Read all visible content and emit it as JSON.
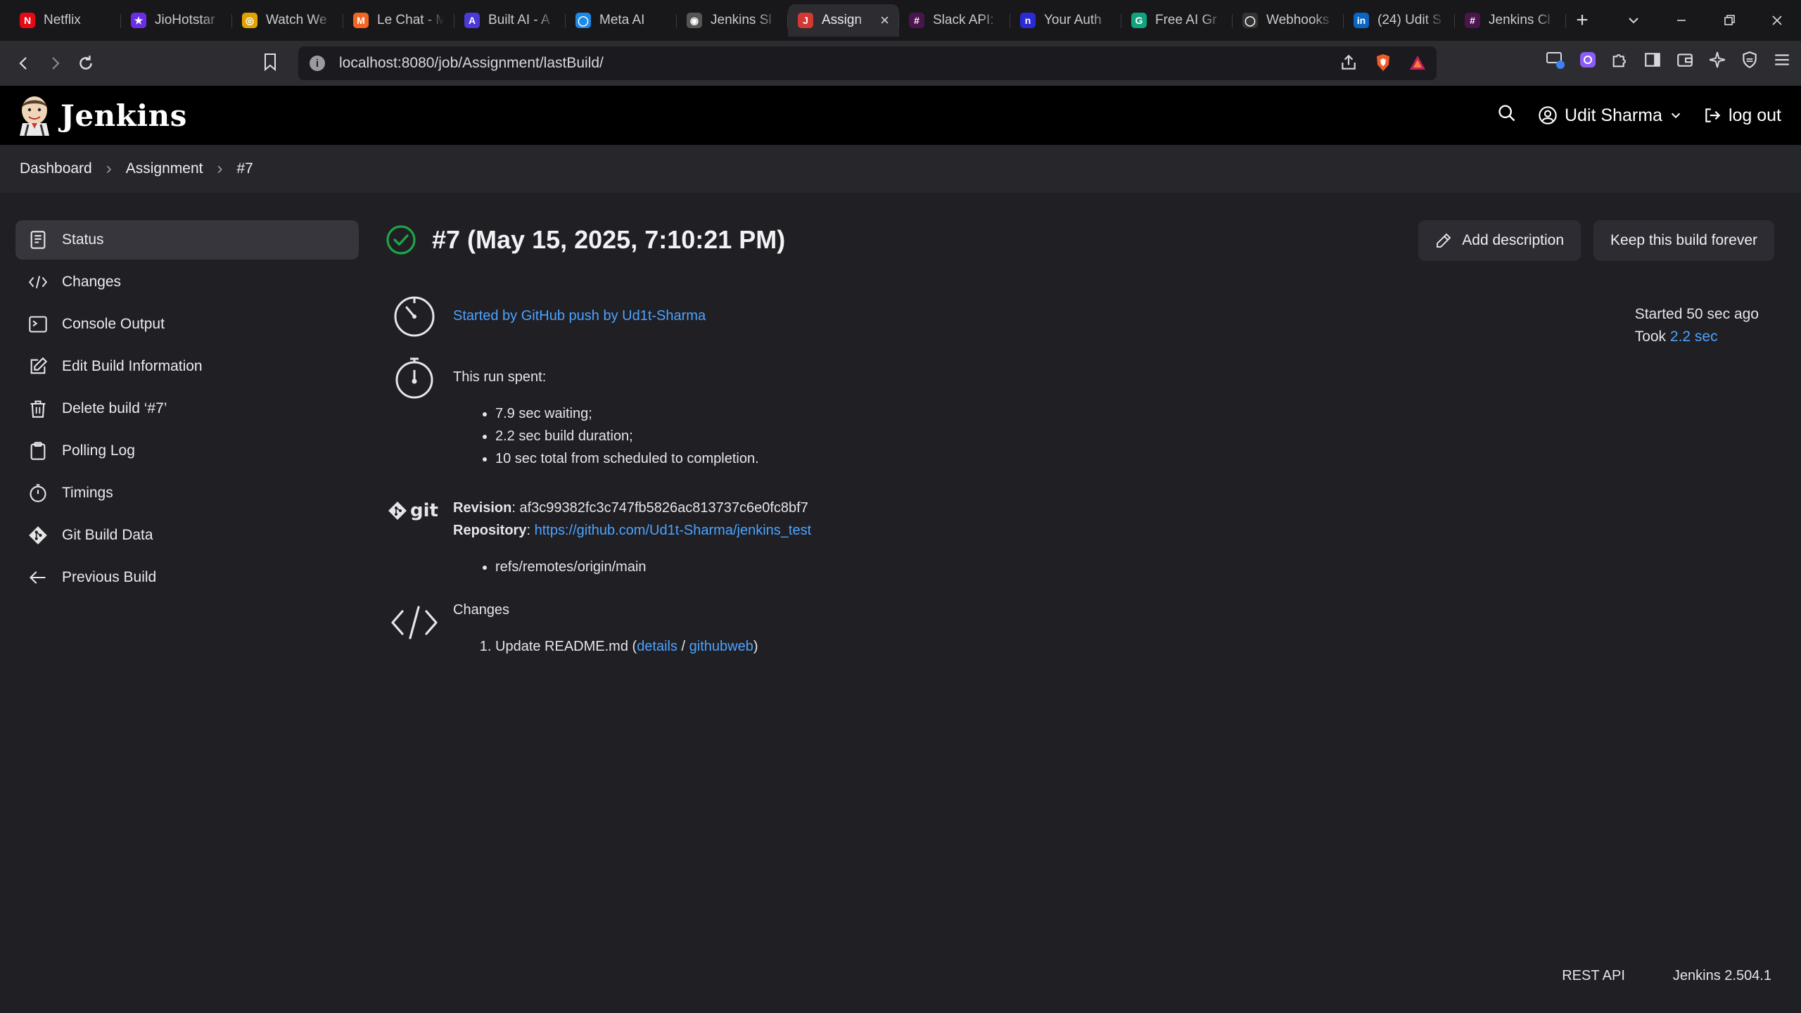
{
  "browser": {
    "tabs": [
      {
        "label": "Netflix",
        "fav_text": "N",
        "fav_color": "#e50914"
      },
      {
        "label": "JioHotstar",
        "fav_text": "★",
        "fav_color": "#6b2ee6"
      },
      {
        "label": "Watch We",
        "fav_text": "◎",
        "fav_color": "#e0a400"
      },
      {
        "label": "Le Chat - M",
        "fav_text": "M",
        "fav_color": "#f26522"
      },
      {
        "label": "Built AI - A",
        "fav_text": "A",
        "fav_color": "#4b3ad6"
      },
      {
        "label": "Meta AI",
        "fav_text": "◯",
        "fav_color": "#1e88e5"
      },
      {
        "label": "Jenkins Sl",
        "fav_text": "◉",
        "fav_color": "#555555"
      },
      {
        "label": "Assign",
        "fav_text": "J",
        "fav_color": "#d33833"
      },
      {
        "label": "Slack API:",
        "fav_text": "#",
        "fav_color": "#4a154b"
      },
      {
        "label": "Your Auth",
        "fav_text": "n",
        "fav_color": "#2b2bd4"
      },
      {
        "label": "Free AI Gr",
        "fav_text": "G",
        "fav_color": "#10a37f"
      },
      {
        "label": "Webhooks",
        "fav_text": "◯",
        "fav_color": "#333333"
      },
      {
        "label": "(24) Udit S",
        "fav_text": "in",
        "fav_color": "#0a66c2"
      },
      {
        "label": "Jenkins Cl",
        "fav_text": "#",
        "fav_color": "#4a154b"
      }
    ],
    "active_tab_index": 7,
    "url": "localhost:8080/job/Assignment/lastBuild/"
  },
  "header": {
    "title": "Jenkins",
    "user": "Udit Sharma",
    "logout": "log out"
  },
  "breadcrumb": [
    "Dashboard",
    "Assignment",
    "#7"
  ],
  "sidebar": {
    "items": [
      {
        "label": "Status",
        "icon": "status-icon",
        "active": true
      },
      {
        "label": "Changes",
        "icon": "code-icon",
        "active": false
      },
      {
        "label": "Console Output",
        "icon": "terminal-icon",
        "active": false
      },
      {
        "label": "Edit Build Information",
        "icon": "edit-icon",
        "active": false
      },
      {
        "label": "Delete build ‘#7’",
        "icon": "trash-icon",
        "active": false
      },
      {
        "label": "Polling Log",
        "icon": "clipboard-icon",
        "active": false
      },
      {
        "label": "Timings",
        "icon": "stopwatch-icon",
        "active": false
      },
      {
        "label": "Git Build Data",
        "icon": "git-icon",
        "active": false
      },
      {
        "label": "Previous Build",
        "icon": "arrow-left-icon",
        "active": false
      }
    ]
  },
  "build": {
    "title": "#7 (May 15, 2025, 7:10:21 PM)",
    "status_color": "#1ea446",
    "add_description": "Add description",
    "keep_forever": "Keep this build forever",
    "started_by": "Started by GitHub push by Ud1t-Sharma",
    "started_ago": "Started 50 sec ago",
    "took_label": "Took",
    "took_value": "2.2 sec",
    "run_spent": "This run spent:",
    "timings": [
      "7.9 sec waiting;",
      "2.2 sec build duration;",
      "10 sec total from scheduled to completion."
    ],
    "revision_label": "Revision",
    "revision": "af3c99382fc3c747fb5826ac813737c6e0fc8bf7",
    "repository_label": "Repository",
    "repository": "https://github.com/Ud1t-Sharma/jenkins_test",
    "branches": [
      "refs/remotes/origin/main"
    ],
    "git_logo": "git",
    "changes_label": "Changes",
    "changes": [
      {
        "text": "Update README.md",
        "details": "details",
        "githubweb": "githubweb"
      }
    ]
  },
  "footer": {
    "rest_api": "REST API",
    "version": "Jenkins 2.504.1"
  }
}
